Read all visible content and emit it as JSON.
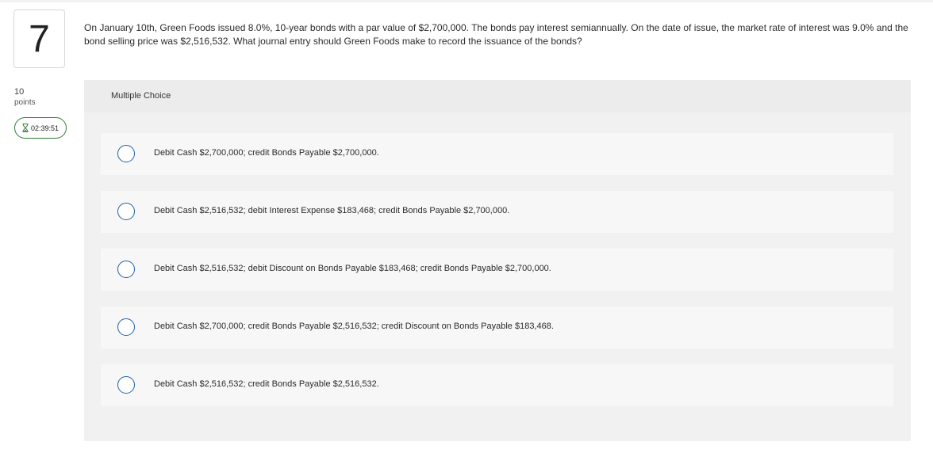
{
  "question": {
    "number": "7",
    "points_value": "10",
    "points_label": "points",
    "timer": "02:39:51",
    "text": "On January 10th, Green Foods issued 8.0%, 10-year bonds with a par value of $2,700,000. The bonds pay interest semiannually. On the date of issue, the market rate of interest was 9.0% and the bond selling price was $2,516,532. What journal entry should Green Foods make to record the issuance of the bonds?"
  },
  "choices": {
    "header": "Multiple Choice",
    "options": [
      {
        "label": "Debit Cash $2,700,000; credit Bonds Payable $2,700,000."
      },
      {
        "label": "Debit Cash $2,516,532; debit Interest Expense $183,468; credit Bonds Payable $2,700,000."
      },
      {
        "label": "Debit Cash $2,516,532; debit Discount on Bonds Payable $183,468; credit Bonds Payable $2,700,000."
      },
      {
        "label": "Debit Cash $2,700,000; credit Bonds Payable $2,516,532; credit Discount on Bonds Payable $183,468."
      },
      {
        "label": "Debit Cash $2,516,532; credit Bonds Payable $2,516,532."
      }
    ]
  },
  "icons": {
    "timer": "hourglass-icon",
    "option": "radio-unselected-icon"
  },
  "colors": {
    "radio_border": "#1f5fa8",
    "timer_border": "#2e7d32",
    "panel_bg": "#f1f1f1"
  }
}
